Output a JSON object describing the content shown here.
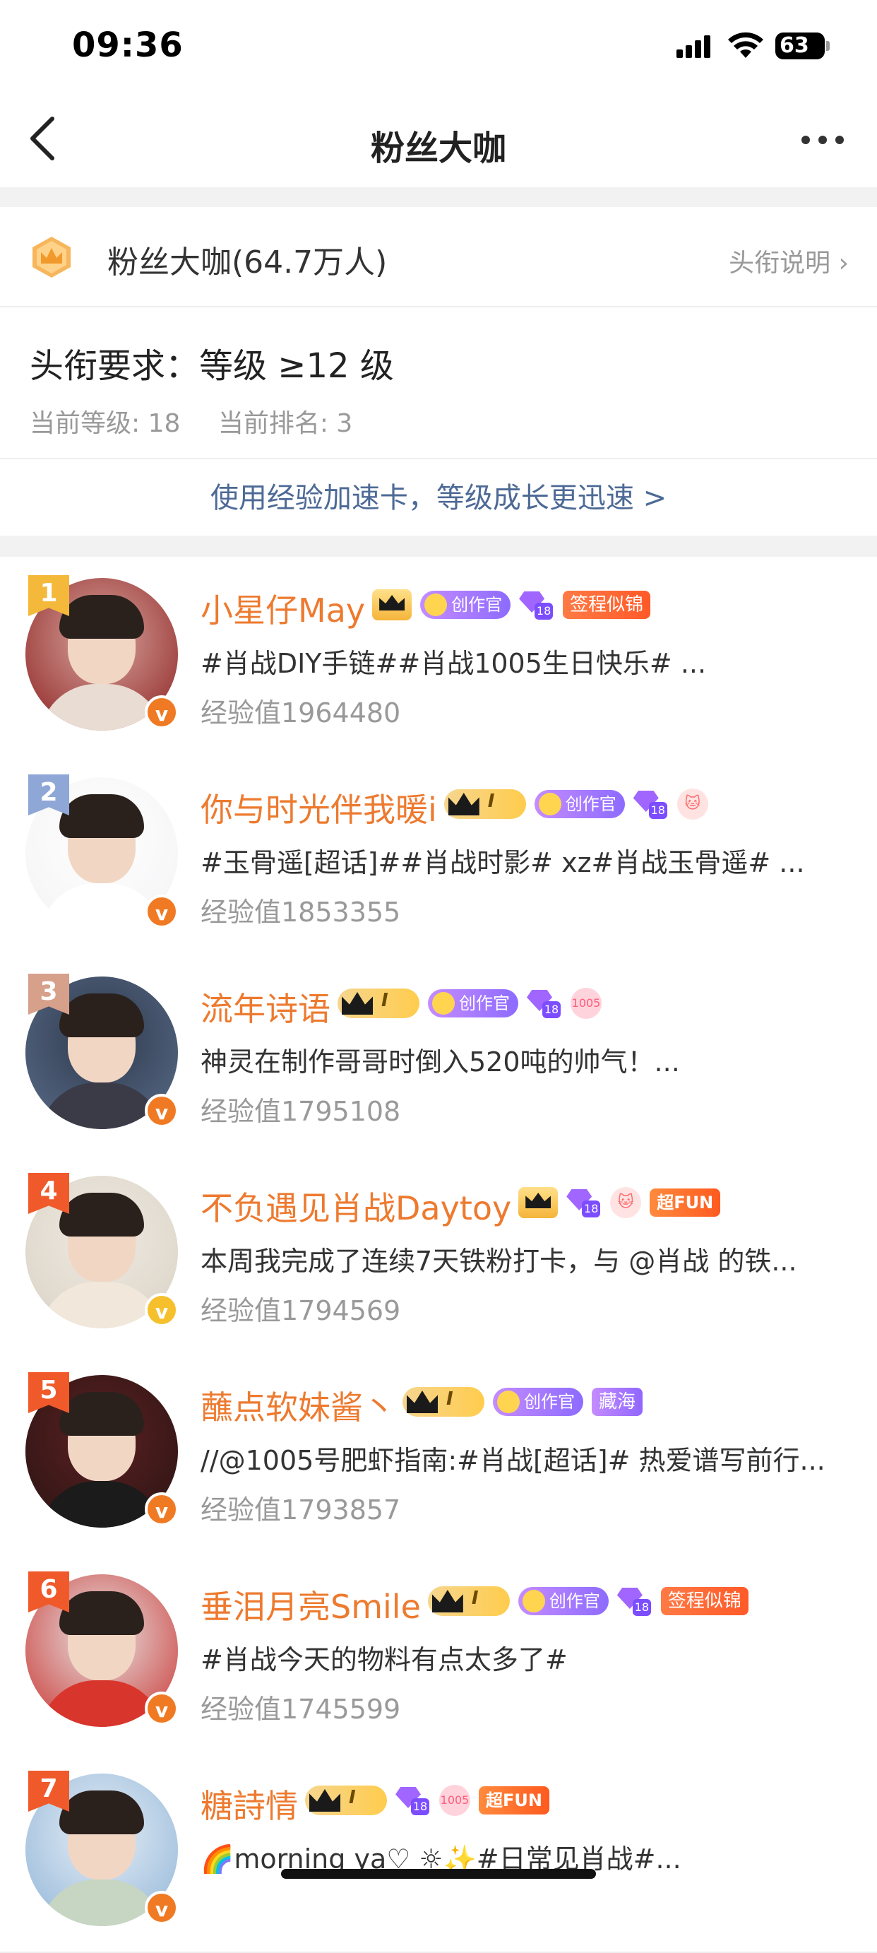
{
  "status_bar": {
    "time": "09:36",
    "battery": "63"
  },
  "nav": {
    "title": "粉丝大咖"
  },
  "title_row": {
    "title": "粉丝大咖(64.7万人)",
    "explain": "头衔说明 ›"
  },
  "requirement": {
    "text": "头衔要求：等级 ≥12 级",
    "current_level": "当前等级: 18",
    "current_rank": "当前排名: 3"
  },
  "accelerate": {
    "text": "使用经验加速卡，等级成长更迅速 >"
  },
  "colors": {
    "accent": "#ed7a2f",
    "rank1": "#f4b83a",
    "rank2": "#8ea7d6",
    "rank3": "#d6a08a",
    "rank_other": "#f05a2a",
    "link": "#4d6a96"
  },
  "list": [
    {
      "rank": "1",
      "name": "小星仔May",
      "badges": [
        "crown",
        "creator",
        "gem",
        "label-orange"
      ],
      "creator_label": "创作官",
      "label": "签程似锦",
      "desc": "#肖战DIY手链##肖战1005生日快乐# ...",
      "exp": "经验值1964480",
      "vip": "orange"
    },
    {
      "rank": "2",
      "name": "你与时光伴我暖i",
      "badges": [
        "fan",
        "creator",
        "gem",
        "pet"
      ],
      "creator_label": "创作官",
      "label": "",
      "desc": "#玉骨遥[超话]##肖战时影# xz#肖战玉骨遥# ...",
      "exp": "经验值1853355",
      "vip": "orange"
    },
    {
      "rank": "3",
      "name": "流年诗语",
      "badges": [
        "fan",
        "creator",
        "gem",
        "rabbit"
      ],
      "creator_label": "创作官",
      "label": "",
      "desc": "神灵在制作哥哥时倒入520吨的帅气！...",
      "exp": "经验值1795108",
      "vip": "orange"
    },
    {
      "rank": "4",
      "name": "不负遇见肖战Daytoy",
      "badges": [
        "crown",
        "gem",
        "pet",
        "fun"
      ],
      "creator_label": "",
      "label": "超FUN",
      "desc": "本周我完成了连续7天铁粉打卡，与 @肖战 的铁...",
      "exp": "经验值1794569",
      "vip": "yellow"
    },
    {
      "rank": "5",
      "name": "蘸点软妹酱丶",
      "badges": [
        "fan",
        "creator",
        "label-purple"
      ],
      "creator_label": "创作官",
      "label": "藏海",
      "desc": "//@1005号肥虾指南:#肖战[超话]# 热爱谱写前行...",
      "exp": "经验值1793857",
      "vip": "orange"
    },
    {
      "rank": "6",
      "name": "垂泪月亮Smile",
      "badges": [
        "fan",
        "creator",
        "gem",
        "label-orange"
      ],
      "creator_label": "创作官",
      "label": "签程似锦",
      "desc": "#肖战今天的物料有点太多了#",
      "exp": "经验值1745599",
      "vip": "orange"
    },
    {
      "rank": "7",
      "name": "糖詩情",
      "badges": [
        "fan",
        "gem",
        "rabbit",
        "fun"
      ],
      "creator_label": "",
      "label": "超FUN",
      "desc": "🌈morning ya♡ ☼✨#日常见肖战#...",
      "exp": "",
      "vip": "orange"
    }
  ]
}
